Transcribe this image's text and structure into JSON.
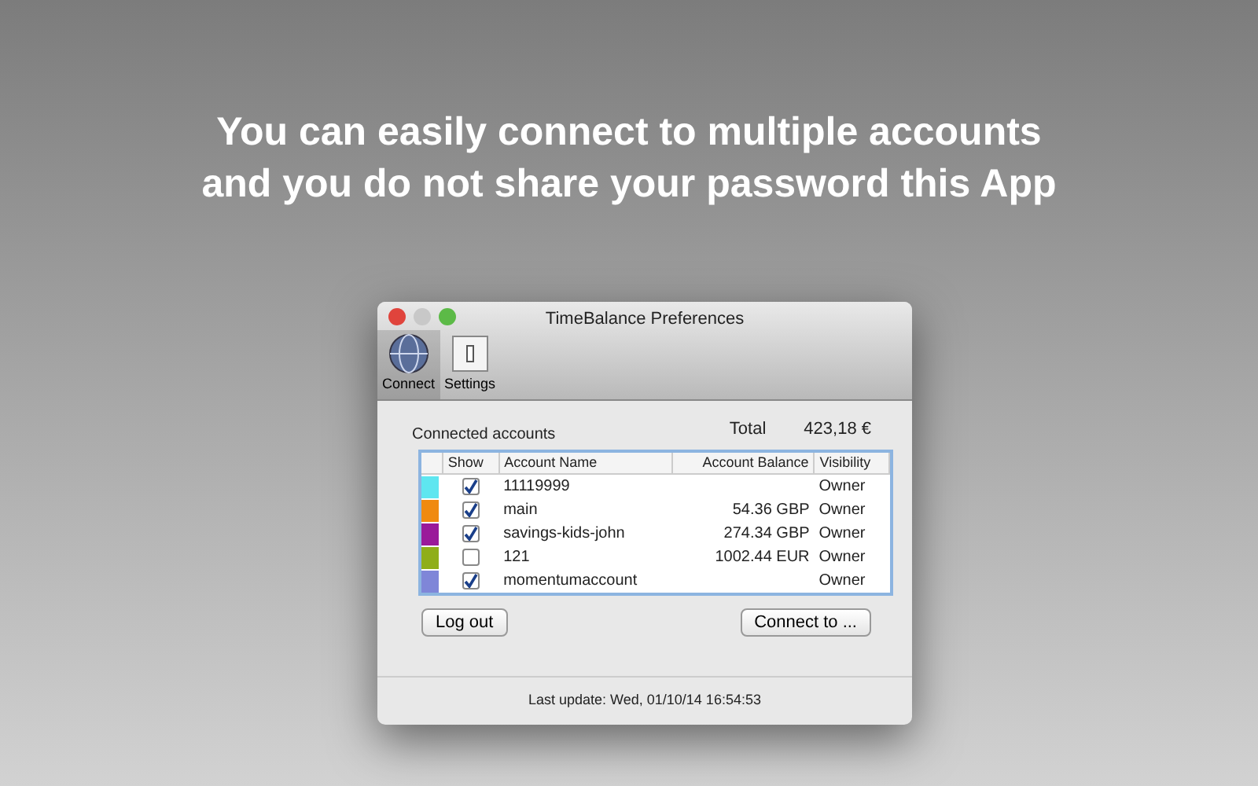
{
  "headline": [
    "You can easily connect to multiple accounts",
    "and you do not share your password this App"
  ],
  "window": {
    "title": "TimeBalance Preferences"
  },
  "toolbar": [
    {
      "label": "Connect",
      "kind": "globe",
      "selected": true
    },
    {
      "label": "Settings",
      "kind": "switch",
      "selected": false
    }
  ],
  "accounts_label": "Connected accounts",
  "total_label": "Total",
  "total_value": "423,18 €",
  "table": {
    "columns": [
      "Show",
      "Account Name",
      "Account Balance",
      "Visibility"
    ],
    "rows": [
      {
        "color": "#5ee6f0",
        "checked": true,
        "name": "11119999",
        "balance": "",
        "visibility": "Owner"
      },
      {
        "color": "#f08a10",
        "checked": true,
        "name": "main",
        "balance": "54.36 GBP",
        "visibility": "Owner"
      },
      {
        "color": "#9a1a9a",
        "checked": true,
        "name": "savings-kids-john",
        "balance": "274.34 GBP",
        "visibility": "Owner"
      },
      {
        "color": "#8fae1a",
        "checked": false,
        "name": "121",
        "balance": "1002.44 EUR",
        "visibility": "Owner"
      },
      {
        "color": "#7f86d8",
        "checked": true,
        "name": "momentumaccount",
        "balance": "",
        "visibility": "Owner"
      }
    ]
  },
  "buttons": [
    "Log out",
    "Connect to ..."
  ],
  "status_bar": "Last update: Wed, 01/10/14 16:54:53"
}
